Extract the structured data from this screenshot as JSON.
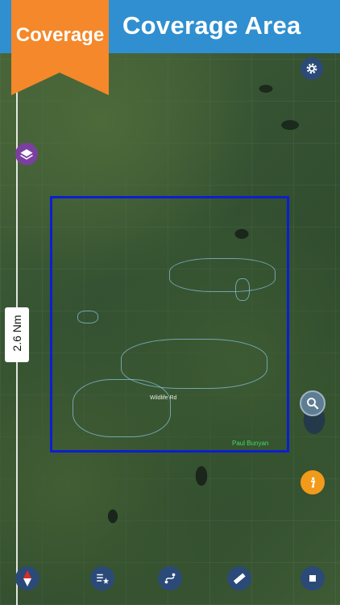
{
  "header": {
    "title": "Coverage Area",
    "badge_label": "Coverage"
  },
  "map": {
    "scale_label": "2.6 Nm",
    "place_label": "Paul Bunyan",
    "city_label": "Wildlife Rd"
  },
  "colors": {
    "header": "#2f8fd0",
    "badge": "#f4882a",
    "coverage_border": "#0b1fd0"
  },
  "icons": {
    "settings": "gear-icon",
    "layers": "layers-icon",
    "search": "search-icon",
    "info": "info-icon",
    "compass": "compass-icon",
    "favorites": "star-list-icon",
    "route": "route-icon",
    "measure": "ruler-icon",
    "stop": "stop-icon"
  }
}
